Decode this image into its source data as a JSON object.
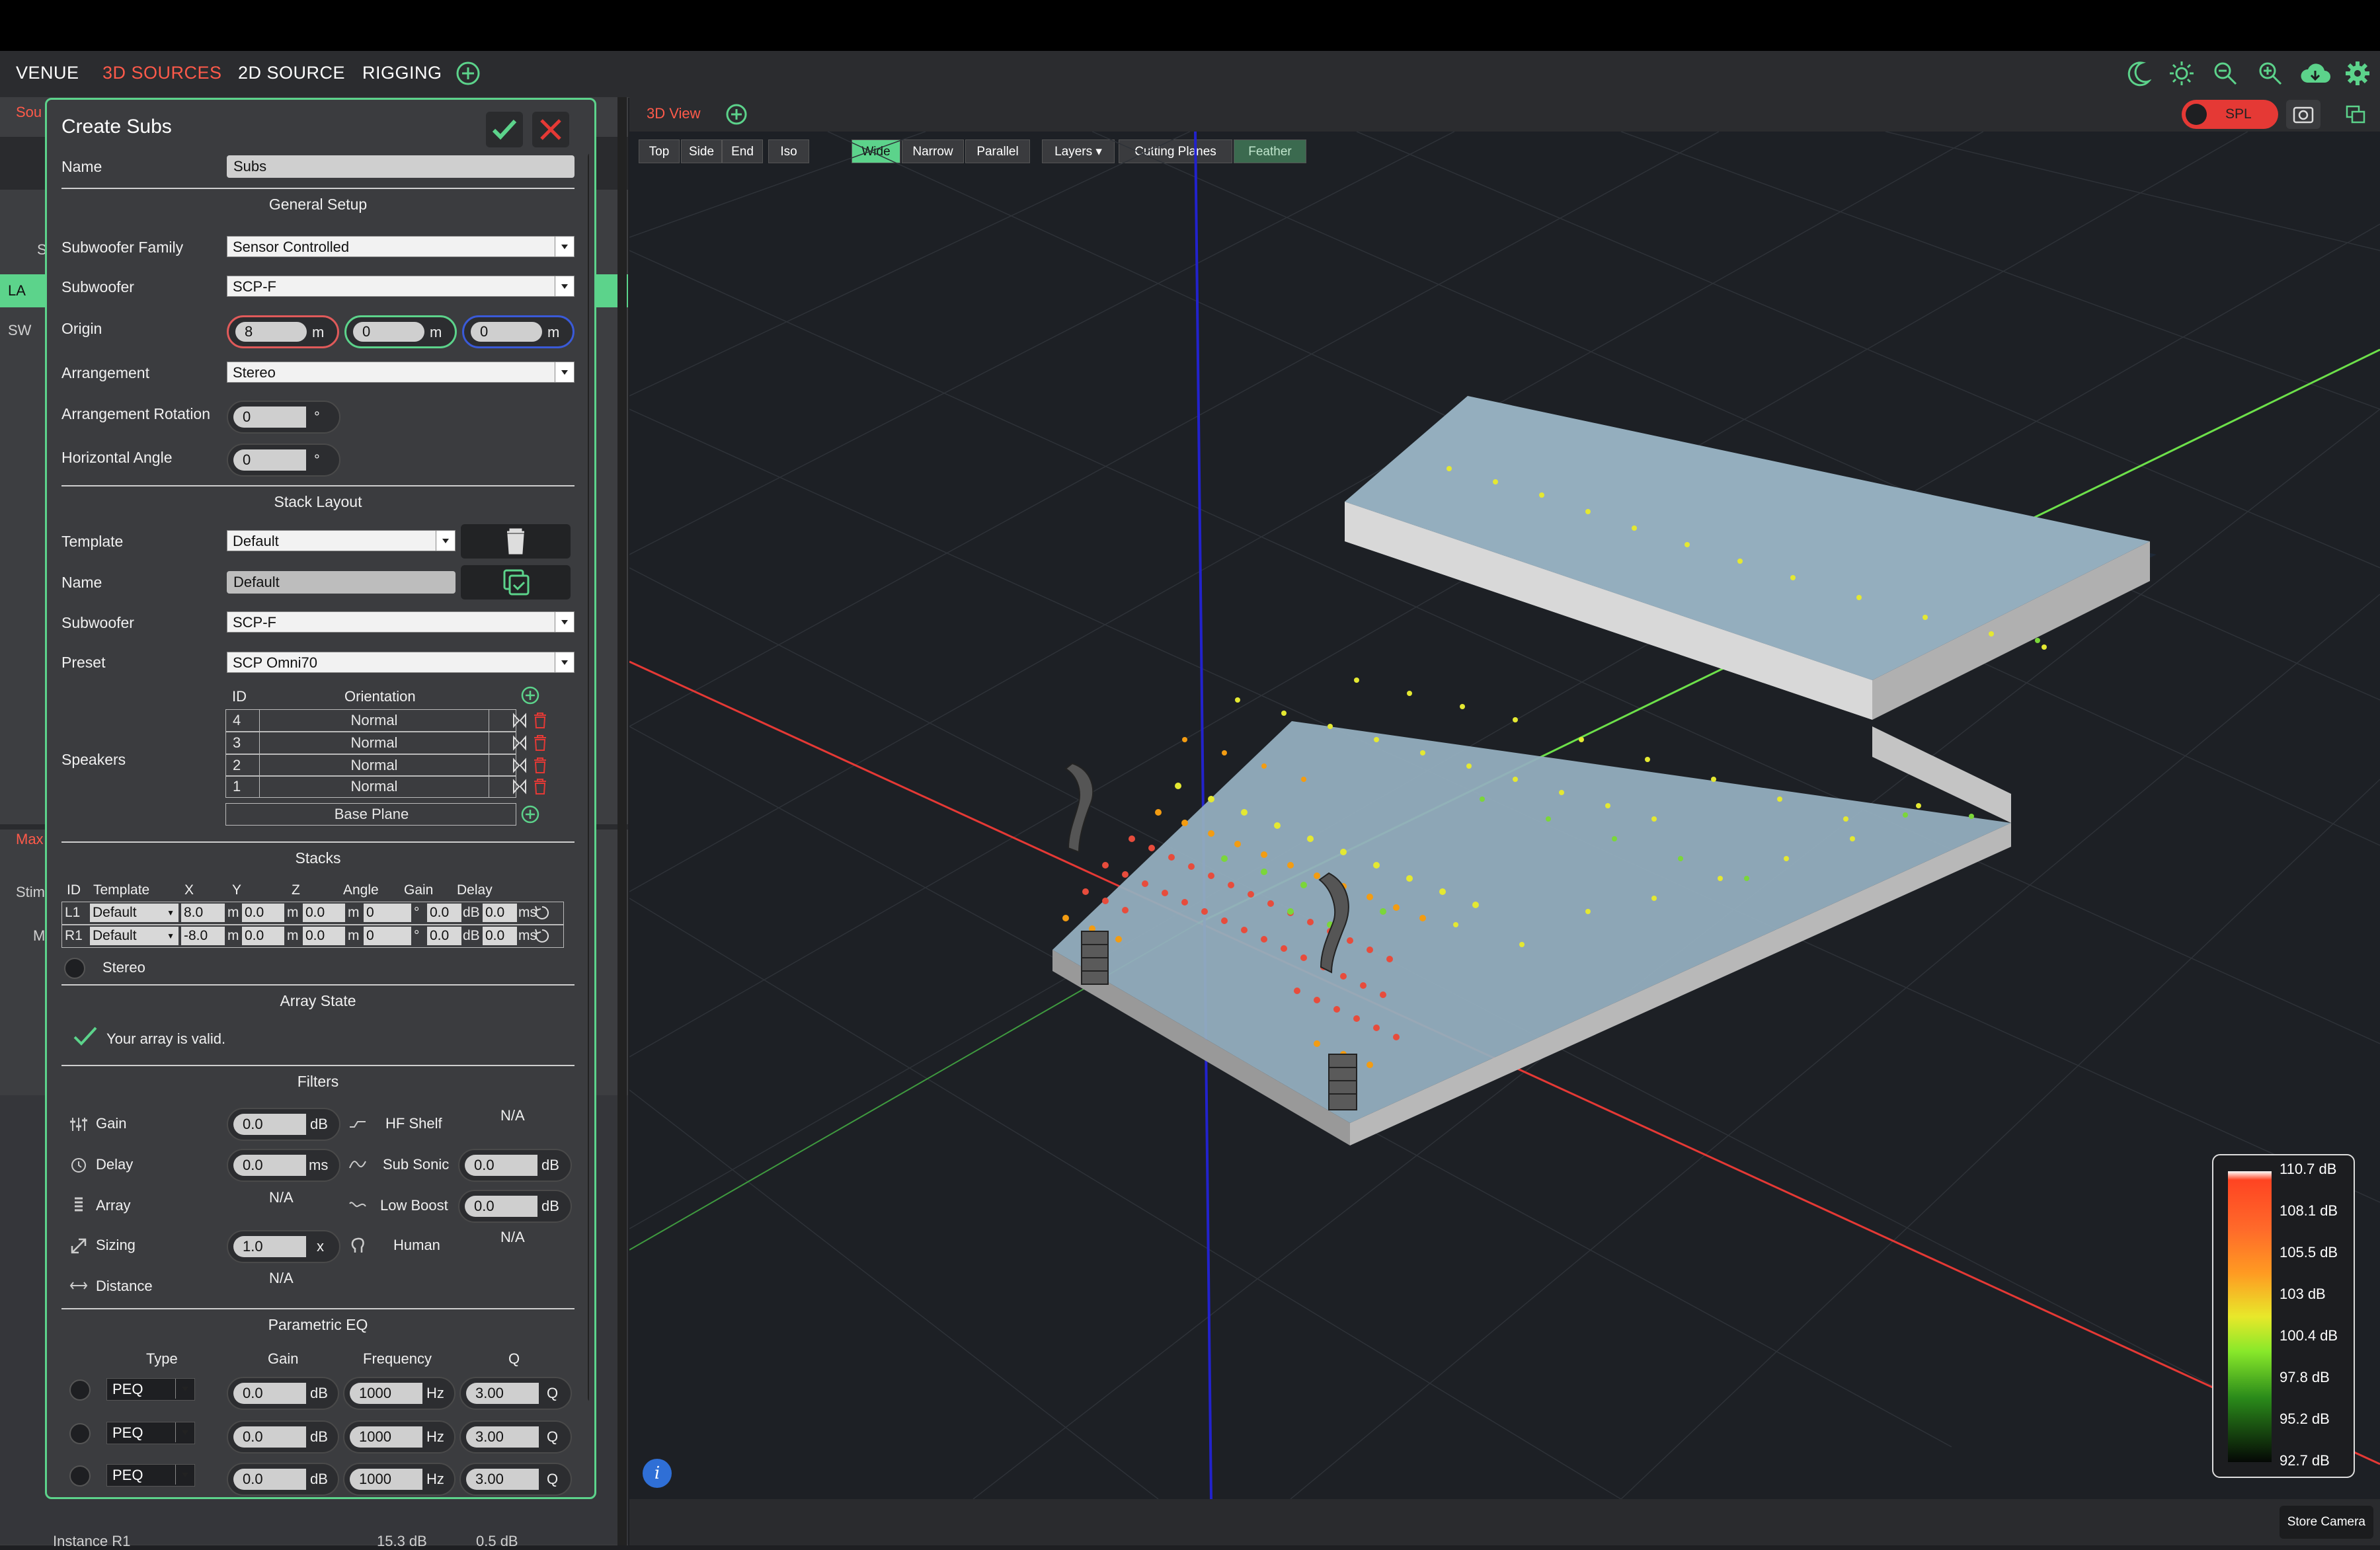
{
  "nav": {
    "venue": "VENUE",
    "sources3d": "3D SOURCES",
    "source2d": "2D SOURCE",
    "rigging": "RIGGING"
  },
  "bg": {
    "sou": "Sou",
    "la": "LA",
    "sw": "SW",
    "s": "S",
    "max": "Max",
    "stim": "Stim",
    "m": "M",
    "instance": "Instance R1",
    "inst_val1": "15.3 dB",
    "inst_val2": "0.5 dB"
  },
  "dialog": {
    "title": "Create Subs",
    "name_label": "Name",
    "name_value": "Subs",
    "general_setup": "General Setup",
    "sub_family_label": "Subwoofer Family",
    "sub_family_value": "Sensor Controlled",
    "subwoofer_label": "Subwoofer",
    "subwoofer_value": "SCP-F",
    "origin_label": "Origin",
    "origin_x": "8",
    "origin_y": "0",
    "origin_z": "0",
    "unit_m": "m",
    "arrangement_label": "Arrangement",
    "arrangement_value": "Stereo",
    "arr_rotation_label": "Arrangement Rotation",
    "arr_rotation_value": "0",
    "horiz_angle_label": "Horizontal Angle",
    "horiz_angle_value": "0",
    "deg": "°",
    "stack_layout": "Stack Layout",
    "template_label": "Template",
    "template_value": "Default",
    "stack_name_label": "Name",
    "stack_name_value": "Default",
    "stack_sub_label": "Subwoofer",
    "stack_sub_value": "SCP-F",
    "preset_label": "Preset",
    "preset_value": "SCP Omni70",
    "speakers_label": "Speakers",
    "spk_id_header": "ID",
    "spk_orient_header": "Orientation",
    "speakers": [
      {
        "id": "4",
        "orientation": "Normal"
      },
      {
        "id": "3",
        "orientation": "Normal"
      },
      {
        "id": "2",
        "orientation": "Normal"
      },
      {
        "id": "1",
        "orientation": "Normal"
      }
    ],
    "base_plane": "Base Plane",
    "stacks": "Stacks",
    "stack_headers": [
      "ID",
      "Template",
      "X",
      "Y",
      "Z",
      "Angle",
      "Gain",
      "Delay"
    ],
    "stack_rows": [
      {
        "id": "L1",
        "template": "Default",
        "x": "8.0",
        "y": "0.0",
        "z": "0.0",
        "angle": "0",
        "gain": "0.0",
        "delay": "0.0"
      },
      {
        "id": "R1",
        "template": "Default",
        "x": "-8.0",
        "y": "0.0",
        "z": "0.0",
        "angle": "0",
        "gain": "0.0",
        "delay": "0.0"
      }
    ],
    "u_m": "m",
    "u_deg": "°",
    "u_db": "dB",
    "u_ms": "ms",
    "stereo": "Stereo",
    "array_state": "Array State",
    "array_valid": "Your array is valid.",
    "filters": "Filters",
    "gain_label": "Gain",
    "gain_value": "0.0",
    "delay_label": "Delay",
    "delay_value": "0.0",
    "array_label": "Array",
    "array_value": "N/A",
    "sizing_label": "Sizing",
    "sizing_value": "1.0",
    "sizing_unit": "x",
    "distance_label": "Distance",
    "distance_value": "N/A",
    "hfshelf_label": "HF Shelf",
    "hfshelf_value": "N/A",
    "subsonic_label": "Sub Sonic",
    "subsonic_value": "0.0",
    "lowboost_label": "Low Boost",
    "lowboost_value": "0.0",
    "human_label": "Human",
    "human_value": "N/A",
    "peq": "Parametric EQ",
    "peq_headers": {
      "type": "Type",
      "gain": "Gain",
      "freq": "Frequency",
      "q": "Q"
    },
    "peq_rows": [
      {
        "type": "PEQ",
        "gain": "0.0",
        "freq": "1000",
        "q": "3.00"
      },
      {
        "type": "PEQ",
        "gain": "0.0",
        "freq": "1000",
        "q": "3.00"
      },
      {
        "type": "PEQ",
        "gain": "0.0",
        "freq": "1000",
        "q": "3.00"
      }
    ],
    "u_hz": "Hz",
    "u_q": "Q"
  },
  "view": {
    "tab": "3D View",
    "buttons": [
      "Top",
      "Side",
      "End",
      "Iso"
    ],
    "lens": [
      "Wide",
      "Narrow",
      "Parallel"
    ],
    "layers": "Layers",
    "cutting": "Cutting Planes",
    "feather": "Feather",
    "spl": "SPL",
    "store_camera": "Store Camera"
  },
  "legend": [
    "110.7 dB",
    "108.1 dB",
    "105.5 dB",
    "103 dB",
    "100.4 dB",
    "97.8 dB",
    "95.2 dB",
    "92.7 dB"
  ],
  "colors": {
    "accent": "#5cd38b",
    "active_tab": "#ff5a4a",
    "danger": "#e53935"
  }
}
